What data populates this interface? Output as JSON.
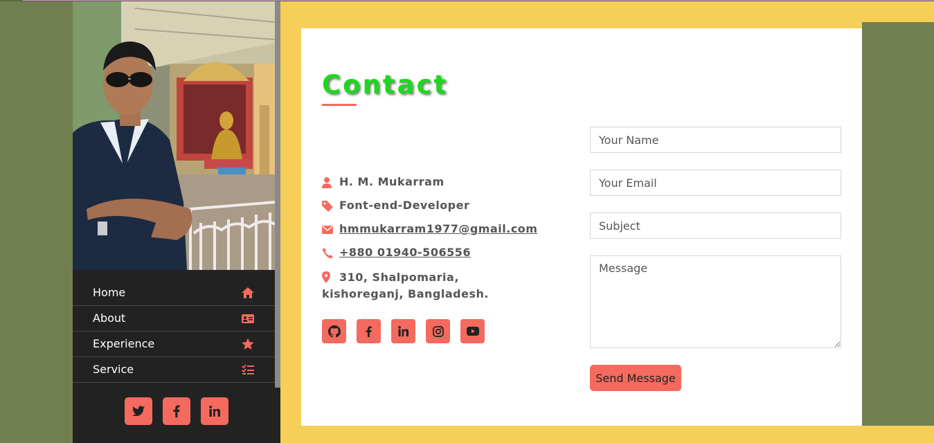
{
  "colors": {
    "accent": "#f46a5e",
    "title": "#1ed71e",
    "yellow": "#f6cf59",
    "olive": "#717f50",
    "sidebar": "#222222"
  },
  "sidebar": {
    "menu": [
      {
        "label": "Home",
        "icon": "home-icon"
      },
      {
        "label": "About",
        "icon": "id-card-icon"
      },
      {
        "label": "Experience",
        "icon": "star-icon"
      },
      {
        "label": "Service",
        "icon": "task-list-icon"
      }
    ],
    "social": [
      "twitter-icon",
      "facebook-icon",
      "linkedin-icon"
    ]
  },
  "contact": {
    "title": "Contact",
    "name": "H. M. Mukarram",
    "role": "Font-end-Developer",
    "email": "hmmukarram1977@gmail.com",
    "phone": "+880 01940-506556",
    "address": "310, Shalpomaria, kishoreganj, Bangladesh.",
    "social": [
      "github-icon",
      "facebook-icon",
      "linkedin-icon",
      "instagram-icon",
      "youtube-icon"
    ]
  },
  "form": {
    "name_placeholder": "Your Name",
    "email_placeholder": "Your Email",
    "subject_placeholder": "Subject",
    "message_placeholder": "Message",
    "submit_label": "Send Message"
  }
}
